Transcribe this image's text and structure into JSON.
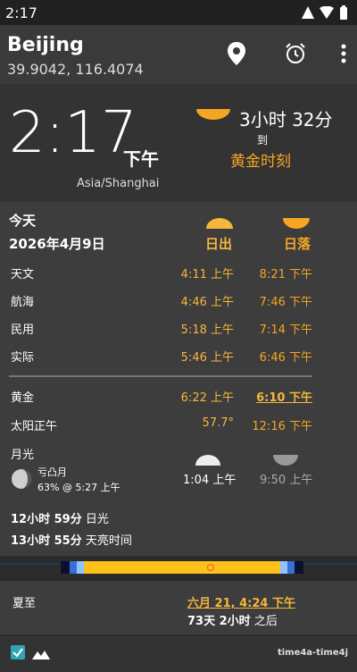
{
  "status": {
    "time": "2:17"
  },
  "header": {
    "city": "Beijing",
    "coords": "39.9042, 116.4074"
  },
  "hero": {
    "time": "2:17",
    "ampm": "下午",
    "timezone": "Asia/Shanghai",
    "countdown": "3小时 32分",
    "to": "到",
    "next_event": "黄金时刻"
  },
  "table": {
    "today": "今天",
    "date": "2026年4月9日",
    "sunrise_label": "日出",
    "sunset_label": "日落",
    "rows": [
      {
        "label": "天文",
        "rise": "4:11 上午",
        "set": "8:21 下午"
      },
      {
        "label": "航海",
        "rise": "4:46 上午",
        "set": "7:46 下午"
      },
      {
        "label": "民用",
        "rise": "5:18 上午",
        "set": "7:14 下午"
      },
      {
        "label": "实际",
        "rise": "5:46 上午",
        "set": "6:46 下午"
      }
    ],
    "golden": {
      "label": "黄金",
      "rise": "6:22 上午",
      "set": "6:10 下午"
    },
    "noon": {
      "label": "太阳正午",
      "angle": "57.7°",
      "time": "12:16 下午"
    },
    "moon": {
      "label": "月光",
      "phase_name": "亏凸月",
      "illum": "63% @ 5:27 上午",
      "rise": "1:04 上午",
      "set": "9:50 上午"
    },
    "daylight_value": "12小时 59分",
    "daylight_label": "日光",
    "sky_value": "13小时 55分",
    "sky_label": "天亮时间"
  },
  "solstice": {
    "label": "夏至",
    "date": "六月 21, 4:24 下午",
    "until_bold": "73天 2小时",
    "until_suffix": "之后"
  },
  "footer": {
    "tag": "time4a-time4j"
  }
}
